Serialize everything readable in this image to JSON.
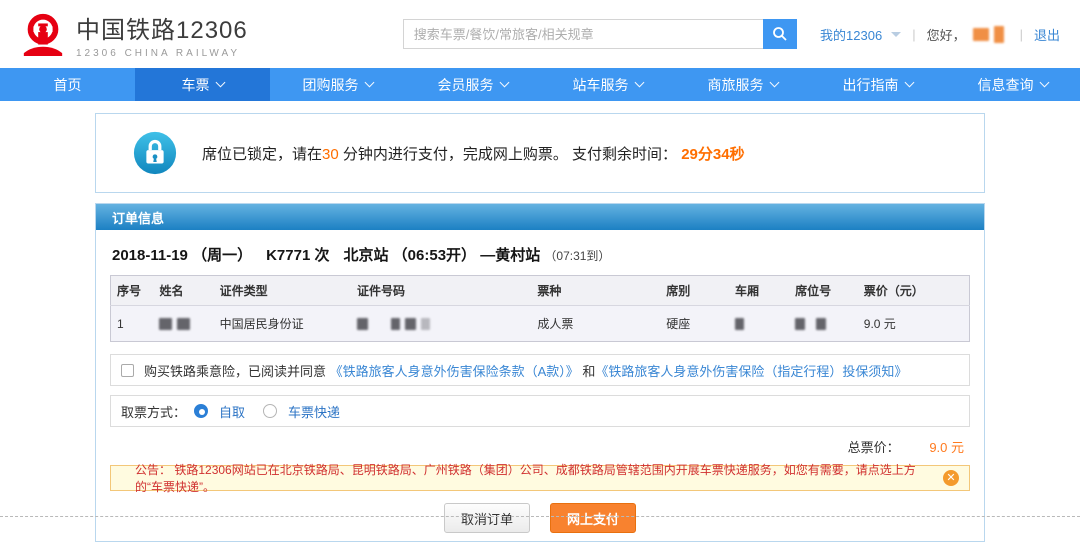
{
  "colors": {
    "nav_blue": "#3e97f2",
    "nav_active_blue": "#2376d8",
    "accent_orange": "#ff6e00",
    "pay_button_orange": "#f8822f",
    "link_blue": "#2c74c5",
    "section_header_gradient_top": "#64b2e1",
    "section_header_gradient_bottom": "#1c80c3",
    "announce_red": "#d03030",
    "announce_bg": "#fffbe0"
  },
  "header": {
    "logo_title": "中国铁路12306",
    "logo_subtitle": "12306 CHINA RAILWAY",
    "search_placeholder": "搜索车票/餐饮/常旅客/相关规章",
    "my_12306": "我的12306",
    "greeting": "您好，",
    "logout": "退出"
  },
  "nav": {
    "items": [
      {
        "label": "首页",
        "active": false,
        "dropdown": false
      },
      {
        "label": "车票",
        "active": true,
        "dropdown": true
      },
      {
        "label": "团购服务",
        "active": false,
        "dropdown": true
      },
      {
        "label": "会员服务",
        "active": false,
        "dropdown": true
      },
      {
        "label": "站车服务",
        "active": false,
        "dropdown": true
      },
      {
        "label": "商旅服务",
        "active": false,
        "dropdown": true
      },
      {
        "label": "出行指南",
        "active": false,
        "dropdown": true
      },
      {
        "label": "信息查询",
        "active": false,
        "dropdown": true
      }
    ]
  },
  "lock_notice": {
    "text_before": "席位已锁定，请在",
    "minutes": "30",
    "text_middle": " 分钟内进行支付，完成网上购票。 支付剩余时间：",
    "countdown": "29分34秒"
  },
  "order": {
    "section_title": "订单信息",
    "train": {
      "date": "2018-11-19",
      "weekday": "（周一）",
      "train_no": "K7771",
      "train_suffix": "次",
      "from_station": "北京站",
      "depart": "（06:53开）",
      "dash": "—",
      "to_station": "黄村站",
      "arrive": "（07:31到）"
    },
    "table": {
      "headers": [
        "序号",
        "姓名",
        "证件类型",
        "证件号码",
        "票种",
        "席别",
        "车厢",
        "席位号",
        "票价（元）"
      ],
      "rows": [
        {
          "seq": "1",
          "name_redacted": true,
          "id_type": "中国居民身份证",
          "id_number_redacted": true,
          "ticket_type": "成人票",
          "seat_class": "硬座",
          "carriage_redacted": true,
          "seat_no_redacted": true,
          "price": "9.0 元"
        }
      ]
    },
    "insurance": {
      "text_before": "购买铁路乘意险，已阅读并同意 ",
      "link_terms": "《铁路旅客人身意外伤害保险条款（A款）》",
      "conjunction": " 和",
      "link_notice": "《铁路旅客人身意外伤害保险（指定行程）投保须知》",
      "checked": false
    },
    "pickup": {
      "label": "取票方式：",
      "options": [
        {
          "label": "自取",
          "selected": true
        },
        {
          "label": "车票快递",
          "selected": false
        }
      ]
    },
    "total": {
      "label": "总票价：",
      "value": "9.0 元"
    },
    "announcement": {
      "prefix": "公告：",
      "text": "铁路12306网站已在北京铁路局、昆明铁路局、广州铁路（集团）公司、成都铁路局管辖范围内开展车票快递服务，如您有需要，请点选上方的“车票快递”。",
      "close": "✕"
    },
    "buttons": {
      "cancel": "取消订单",
      "pay": "网上支付"
    }
  }
}
